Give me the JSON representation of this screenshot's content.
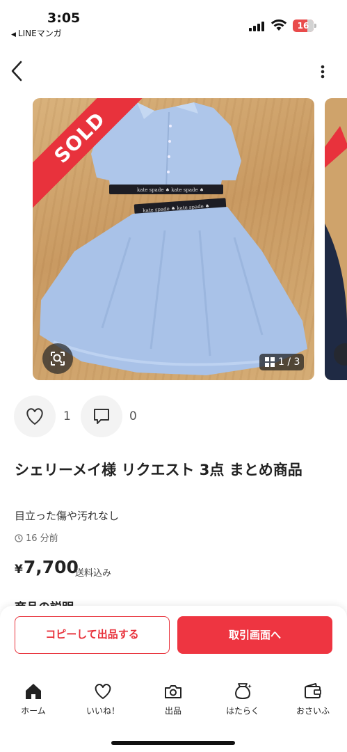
{
  "status_bar": {
    "time": "3:05",
    "back_app": "LINEマンガ",
    "battery_level": "16"
  },
  "product": {
    "sold_label": "SOLD",
    "photo_counter": "1 / 3",
    "likes": "1",
    "comments": "0",
    "title": "シェリーメイ様 リクエスト 3点 まとめ商品",
    "condition": "目立った傷や汚れなし",
    "posted": "16 分前",
    "price_symbol": "¥",
    "price": "7,700",
    "shipping": "送料込み",
    "description_heading": "商品の説明"
  },
  "actions": {
    "copy_label": "コピーして出品する",
    "trade_label": "取引画面へ"
  },
  "tabs": [
    {
      "label": "ホーム",
      "icon": "home-icon"
    },
    {
      "label": "いいね！",
      "icon": "heart-icon"
    },
    {
      "label": "出品",
      "icon": "camera-icon"
    },
    {
      "label": "はたらく",
      "icon": "coin-bag-icon"
    },
    {
      "label": "おさいふ",
      "icon": "wallet-icon"
    }
  ],
  "colors": {
    "accent": "#ee3541",
    "sold_ribbon": "#e8323c"
  }
}
